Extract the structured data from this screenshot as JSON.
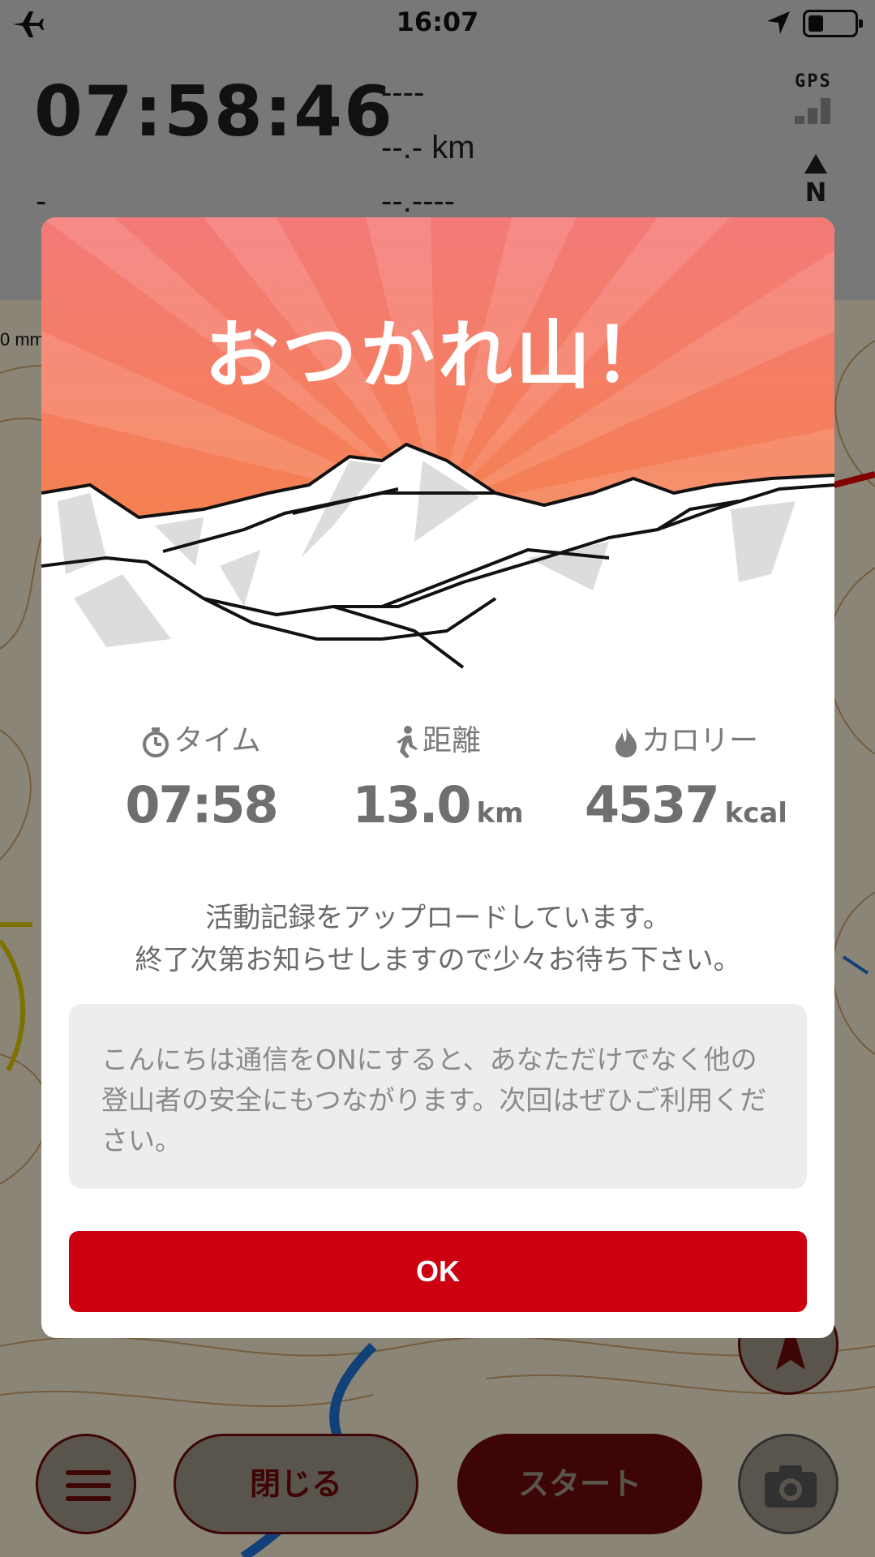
{
  "status_bar": {
    "time": "16:07"
  },
  "header": {
    "elapsed_time": "07:58:46",
    "readout_1": "----",
    "readout_2": "--.- km",
    "readout_3": "--.----",
    "left_readout": "-",
    "gps_label": "GPS",
    "north_label": "N",
    "scale_label": "0 mm"
  },
  "toolbar": {
    "close_label": "閉じる",
    "start_label": "スタート"
  },
  "modal": {
    "title": "おつかれ山！",
    "stats": [
      {
        "label": "タイム",
        "value": "07:58",
        "unit": ""
      },
      {
        "label": "距離",
        "value": "13.0",
        "unit": "km"
      },
      {
        "label": "カロリー",
        "value": "4537",
        "unit": "kcal"
      }
    ],
    "message_line1": "活動記録をアップロードしています。",
    "message_line2": "終了次第お知らせしますので少々お待ち下さい。",
    "notice_text": "こんにちは通信をONにすると、あなただけでなく他の登山者の安全にもつながります。次回はぜひご利用ください。",
    "ok_label": "OK"
  },
  "colors": {
    "accent": "#cc0011",
    "banner_top": "#f47a78",
    "banner_bottom": "#f6843e"
  }
}
